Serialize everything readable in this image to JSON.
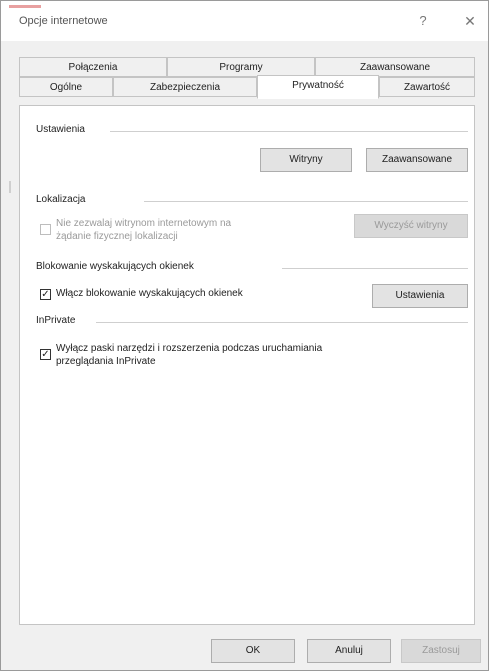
{
  "window": {
    "title": "Opcje internetowe",
    "help_glyph": "?",
    "close_glyph": "✕"
  },
  "tabs": {
    "row1": [
      "Połączenia",
      "Programy",
      "Zaawansowane"
    ],
    "row2": [
      "Ogólne",
      "Zabezpieczenia",
      "Prywatność",
      "Zawartość"
    ],
    "active": "Prywatność"
  },
  "settings": {
    "group_label": "Ustawienia",
    "sites_button": "Witryny",
    "advanced_button": "Zaawansowane"
  },
  "location": {
    "group_label": "Lokalizacja",
    "checkbox_label_line1": "Nie zezwalaj witrynom internetowym na",
    "checkbox_label_line2": "żądanie fizycznej lokalizacji",
    "checkbox_checked": false,
    "clear_sites_button": "Wyczyść witryny"
  },
  "popup": {
    "group_label": "Blokowanie wyskakujących okienek",
    "checkbox_label": "Włącz blokowanie wyskakujących okienek",
    "checkbox_checked": true,
    "settings_button": "Ustawienia"
  },
  "inprivate": {
    "group_label": "InPrivate",
    "checkbox_label_line1": "Wyłącz paski narzędzi i rozszerzenia podczas uruchamiania",
    "checkbox_label_line2": "przeglądania InPrivate",
    "checkbox_checked": true
  },
  "footer": {
    "ok": "OK",
    "cancel": "Anuluj",
    "apply": "Zastosuj"
  },
  "check_glyph": "✓"
}
